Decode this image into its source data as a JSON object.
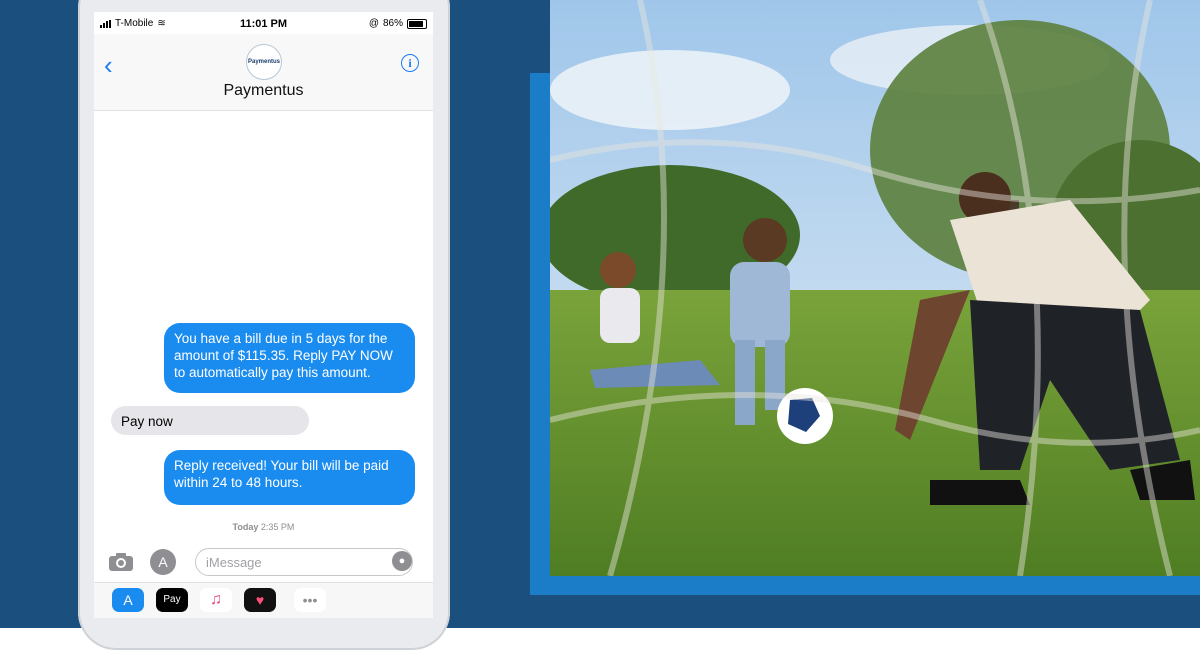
{
  "colors": {
    "background": "#1b4f7d",
    "frame_accent": "#1b7cc8",
    "imessage_blue": "#1a8cf0",
    "incoming_gray": "#e6e6ea"
  },
  "status_bar": {
    "carrier": "T-Mobile",
    "time": "11:01 PM",
    "battery": "86%"
  },
  "header": {
    "back_icon": "chevron-left-icon",
    "avatar_text": "Paymentus",
    "contact_name": "Paymentus",
    "info_icon": "info-icon"
  },
  "messages": [
    {
      "direction": "outgoing",
      "text": "You have a bill due in 5 days for the amount of $115.35. Reply PAY NOW to automatically pay this amount."
    },
    {
      "direction": "incoming",
      "text": "Pay now"
    },
    {
      "direction": "outgoing",
      "text": "Reply received! Your bill will be paid within 24 to 48 hours."
    }
  ],
  "timestamp": {
    "day": "Today",
    "time": "2:35 PM"
  },
  "input": {
    "placeholder": "iMessage"
  },
  "app_drawer": [
    {
      "name": "app-store-icon"
    },
    {
      "name": "apple-pay-icon",
      "label": "Pay"
    },
    {
      "name": "music-icon"
    },
    {
      "name": "digital-touch-icon"
    },
    {
      "name": "more-icon"
    }
  ]
}
